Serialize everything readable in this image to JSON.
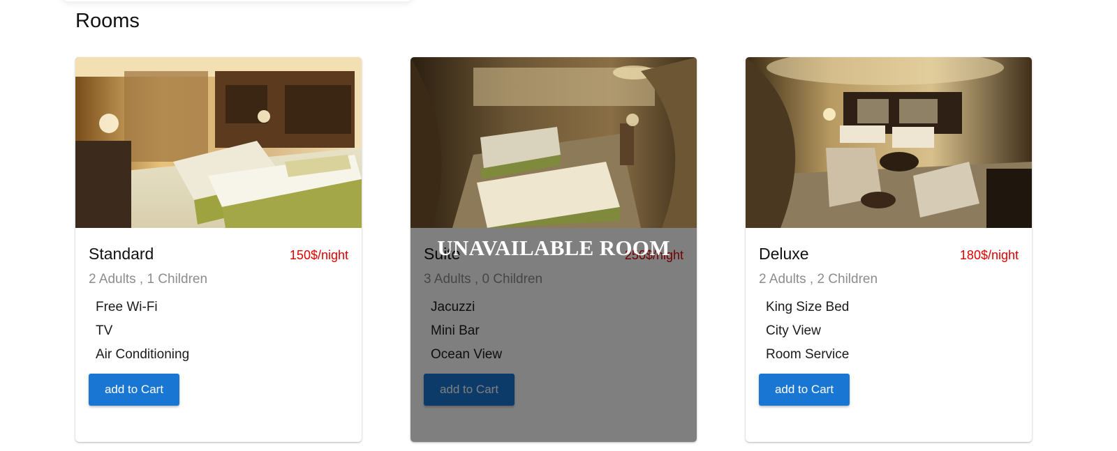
{
  "page": {
    "title": "Rooms"
  },
  "rooms": [
    {
      "name": "Standard",
      "price": "150$/night",
      "occupancy": "2 Adults , 1 Children",
      "amenities": [
        "Free Wi-Fi",
        "TV",
        "Air Conditioning"
      ],
      "button": "add to Cart",
      "available": true
    },
    {
      "name": "Suite",
      "price": "250$/night",
      "occupancy": "3 Adults , 0 Children",
      "amenities": [
        "Jacuzzi",
        "Mini Bar",
        "Ocean View"
      ],
      "button": "add to Cart",
      "available": false,
      "overlay_label": "UNAVAILABLE ROOM"
    },
    {
      "name": "Deluxe",
      "price": "180$/night",
      "occupancy": "2 Adults , 2 Children",
      "amenities": [
        "King Size Bed",
        "City View",
        "Room Service"
      ],
      "button": "add to Cart",
      "available": true
    }
  ],
  "colors": {
    "price": "#e00000",
    "button": "#1976d2",
    "muted": "#8d8d8d"
  }
}
